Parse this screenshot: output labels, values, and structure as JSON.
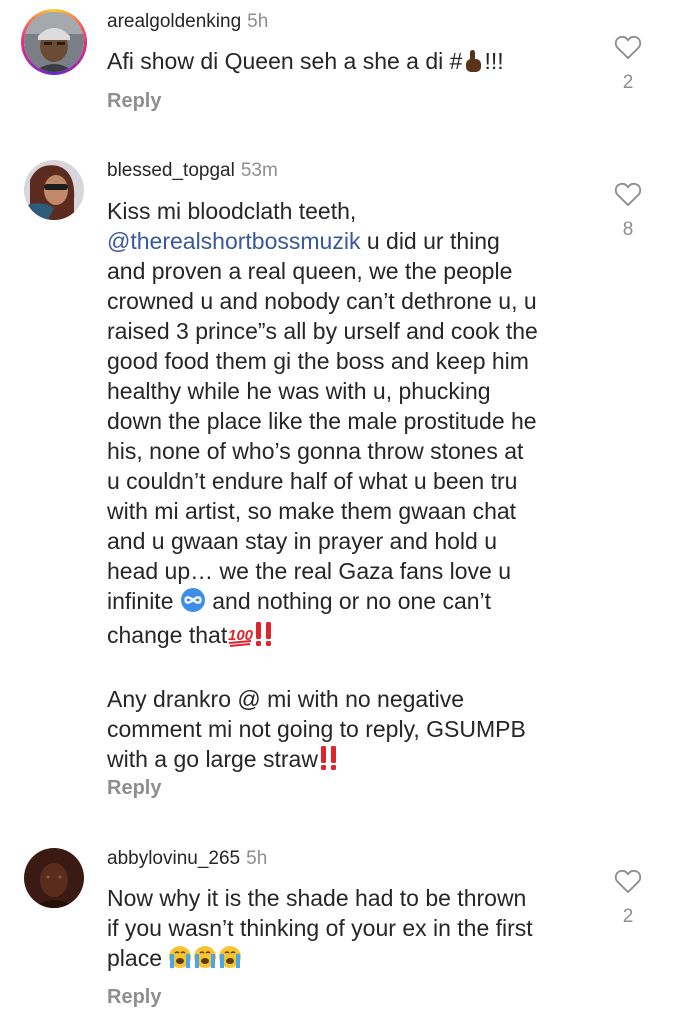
{
  "comments": [
    {
      "username": "arealgoldenking",
      "time": "5h",
      "text_parts": [
        "Afi show di Queen seh a she a di #",
        "!!!"
      ],
      "reply_label": "Reply",
      "like_count": "2",
      "avatar_icon": "profile-photo-man-cap",
      "has_story_ring": true
    },
    {
      "username": "blessed_topgal",
      "time": "53m",
      "lines": {
        "l1": "Kiss mi bloodclath teeth,",
        "mention": "@therealshortbossmuzik",
        "l2_rest": " u did ur thing",
        "l3": "and proven a real queen, we the people",
        "l4": "crowned u and nobody can’t dethrone u, u",
        "l5": "raised 3 prince”s all by urself and cook the",
        "l6": "good food them gi the boss and keep him",
        "l7": "healthy while he was with u, phucking",
        "l8": "down the place like the male prostitude he",
        "l9": "his, none of who’s gonna throw stones at",
        "l10": "u couldn’t endure half of what u been tru",
        "l11": "with mi artist, so make them gwaan chat",
        "l12": "and u gwaan stay in prayer and hold u",
        "l13": "head up… we the real Gaza fans love u",
        "l14a": "infinite ",
        "l14b": " and nothing or no one can’t",
        "l15": "change that",
        "p2l1": "Any drankro @ mi with no negative",
        "p2l2": "comment mi not going to reply, GSUMPB",
        "p2l3": "with a go large straw"
      },
      "reply_label": "Reply",
      "like_count": "8",
      "avatar_icon": "profile-photo-woman-sunglasses"
    },
    {
      "username": "abbylovinu_265",
      "time": "5h",
      "lines": {
        "l1": "Now why it is the shade had to be thrown",
        "l2": "if you wasn’t thinking of your ex in the first",
        "l3": "place "
      },
      "reply_label": "Reply",
      "like_count": "2",
      "avatar_icon": "profile-photo-dark"
    }
  ],
  "colors": {
    "text": "#262626",
    "secondary": "#8e8e8e",
    "mention": "#385898",
    "double_exclamation": "#e0242c"
  },
  "icons": [
    "heart-outline-icon",
    "point-up-emoji",
    "infinity-emoji",
    "hundred-points-emoji",
    "double-exclamation-emoji",
    "loudly-crying-face-emoji"
  ]
}
